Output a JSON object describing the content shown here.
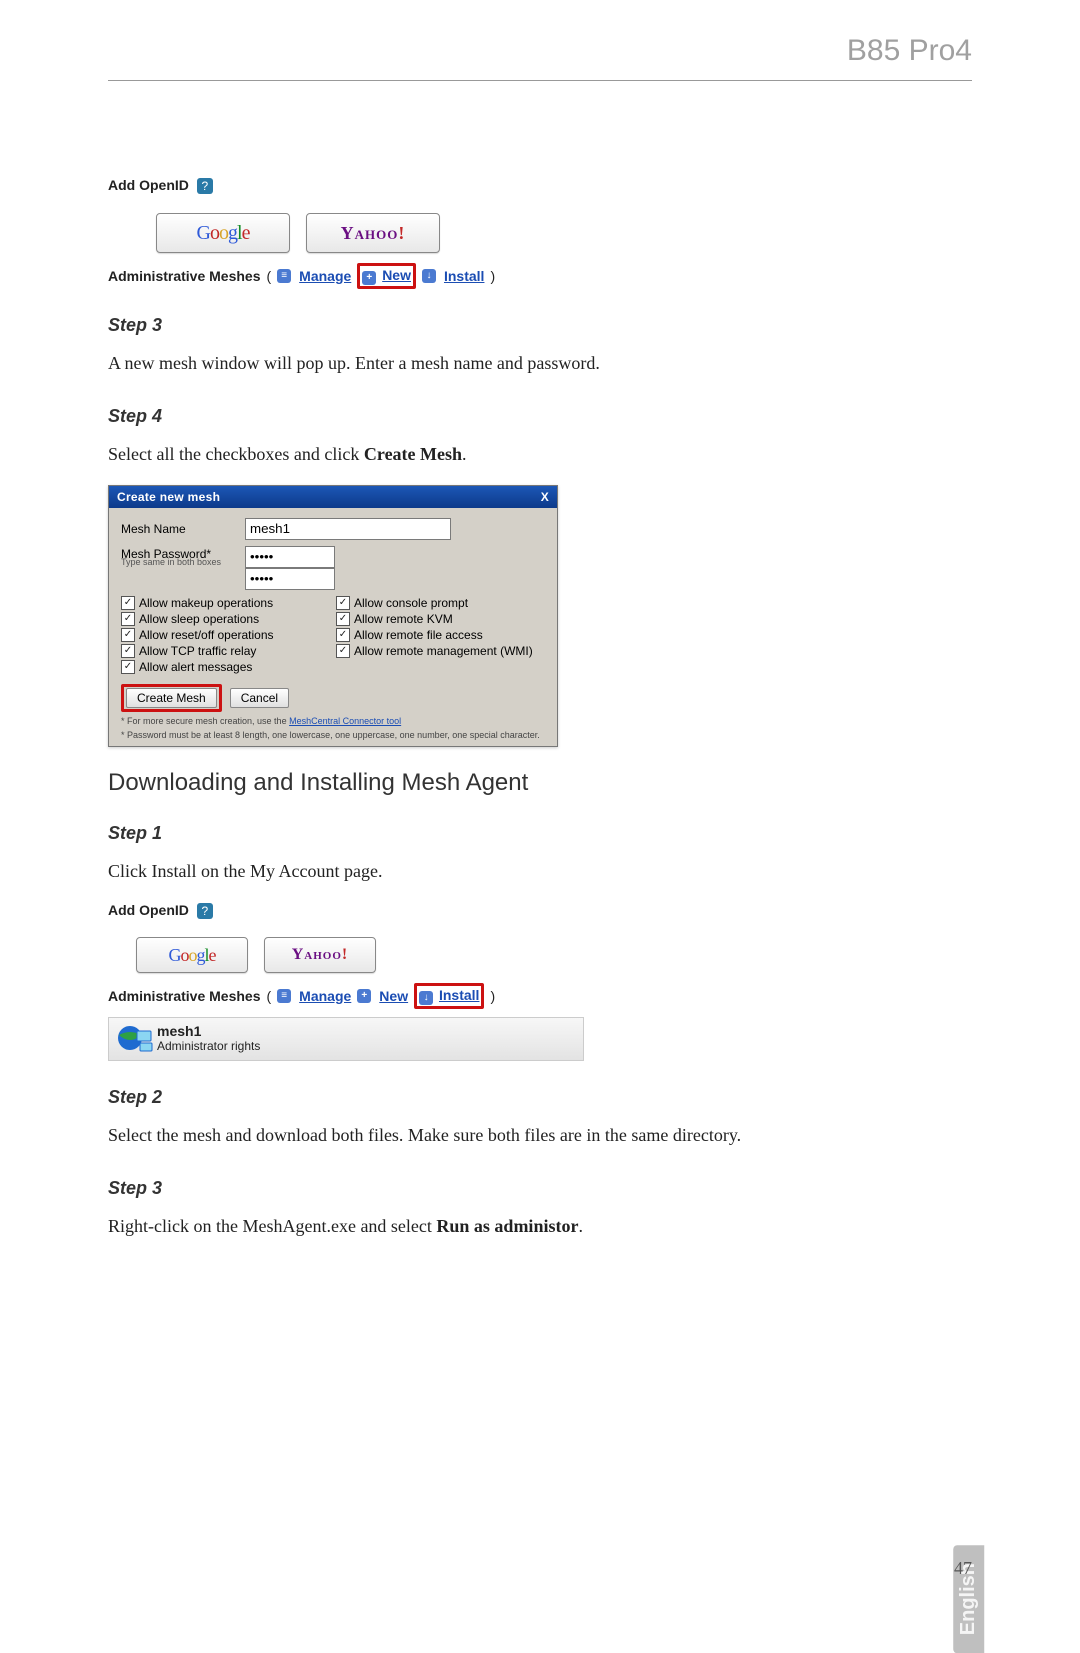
{
  "header": {
    "product": "B85 Pro4"
  },
  "figure1": {
    "addopenid_label": "Add OpenID",
    "google": "Google",
    "yahoo": "Yahoo!",
    "adminmesh_label": "Administrative Meshes",
    "link_manage": "Manage",
    "link_new": "New",
    "link_install": "Install"
  },
  "step3": {
    "label": "Step 3",
    "text": "A new mesh window will pop up. Enter a mesh name and password."
  },
  "step4": {
    "label": "Step 4",
    "text_before": "Select all the checkboxes and click ",
    "text_bold": "Create Mesh",
    "text_after": "."
  },
  "dialog": {
    "title": "Create new mesh",
    "close": "X",
    "name_label": "Mesh Name",
    "name_value": "mesh1",
    "pw_label": "Mesh Password*",
    "pw_hint": "Type same in both boxes",
    "pw_value": "•••••",
    "checks": [
      "Allow makeup operations",
      "Allow console prompt",
      "Allow sleep operations",
      "Allow remote KVM",
      "Allow reset/off operations",
      "Allow remote file access",
      "Allow TCP traffic relay",
      "Allow remote management (WMI)",
      "Allow alert messages"
    ],
    "btn_create": "Create Mesh",
    "btn_cancel": "Cancel",
    "fine1_before": "* For more secure mesh creation, use the ",
    "fine1_link": "MeshCentral Connector tool",
    "fine2": "* Password must be at least 8 length, one lowercase, one uppercase, one number, one special character."
  },
  "section2": {
    "title": "Downloading and Installing Mesh Agent"
  },
  "s2_step1": {
    "label": "Step 1",
    "text": "Click Install on the My Account page."
  },
  "figure2": {
    "addopenid_label": "Add OpenID",
    "google": "Google",
    "yahoo": "Yahoo!",
    "adminmesh_label": "Administrative Meshes",
    "link_manage": "Manage",
    "link_new": "New",
    "link_install": "Install",
    "mesh_title": "mesh1",
    "mesh_sub": "Administrator rights"
  },
  "s2_step2": {
    "label": "Step 2",
    "text": "Select the mesh and download both files. Make sure both files are in the same directory."
  },
  "s2_step3": {
    "label": "Step 3",
    "text_before": "Right-click on the MeshAgent.exe and select ",
    "text_bold": "Run as administor",
    "text_after": "."
  },
  "footer": {
    "lang": "English",
    "page": "47"
  }
}
